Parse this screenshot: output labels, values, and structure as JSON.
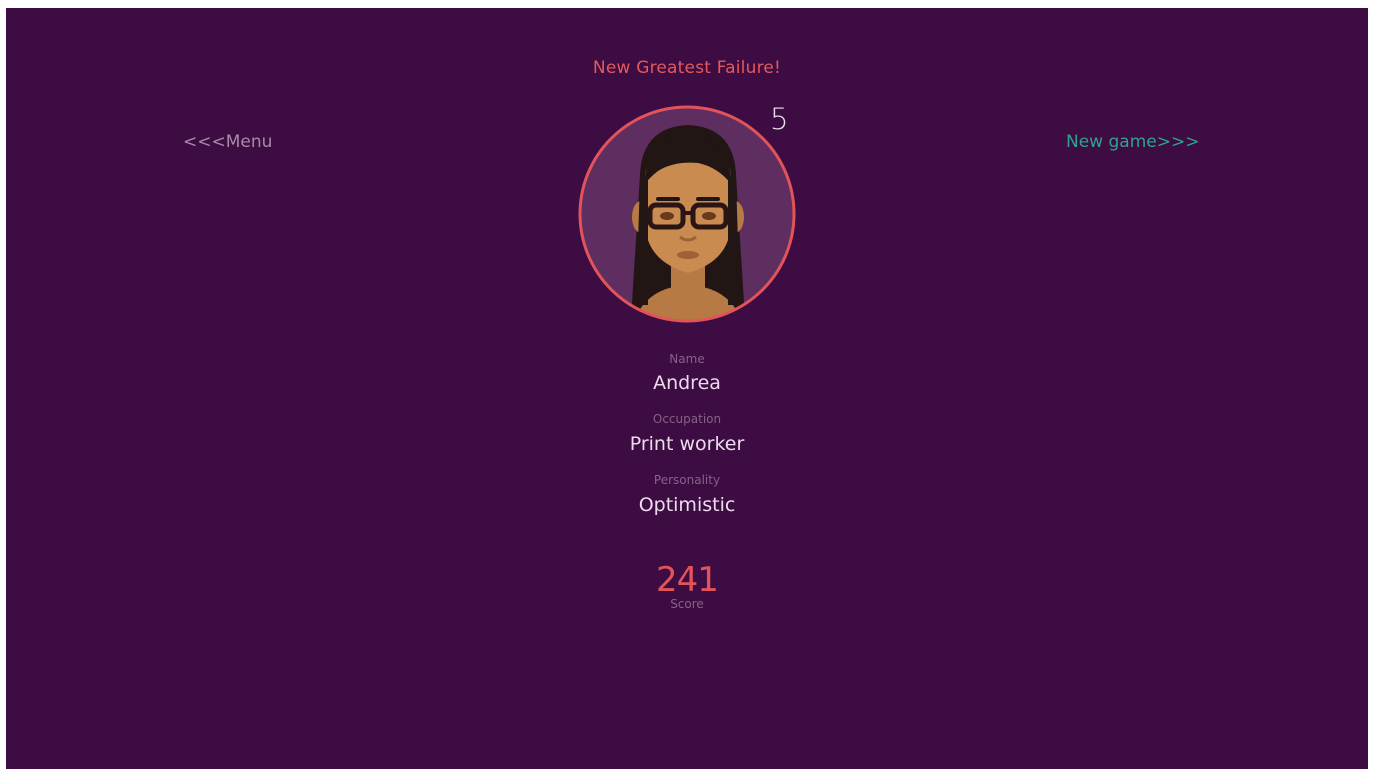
{
  "headline": "New Greatest Failure!",
  "nav": {
    "menu_label": "<<<Menu",
    "new_game_label": "New game>>>"
  },
  "character": {
    "level": "5",
    "name_label": "Name",
    "name": "Andrea",
    "occupation_label": "Occupation",
    "occupation": "Print worker",
    "personality_label": "Personality",
    "personality": "Optimistic"
  },
  "score": {
    "value": "241",
    "label": "Score"
  },
  "colors": {
    "background": "#3d0c42",
    "accent": "#e2535a",
    "new_game": "#2fa38f",
    "menu": "#a98aa9"
  },
  "icons": {
    "avatar": "woman-with-glasses-portrait"
  }
}
